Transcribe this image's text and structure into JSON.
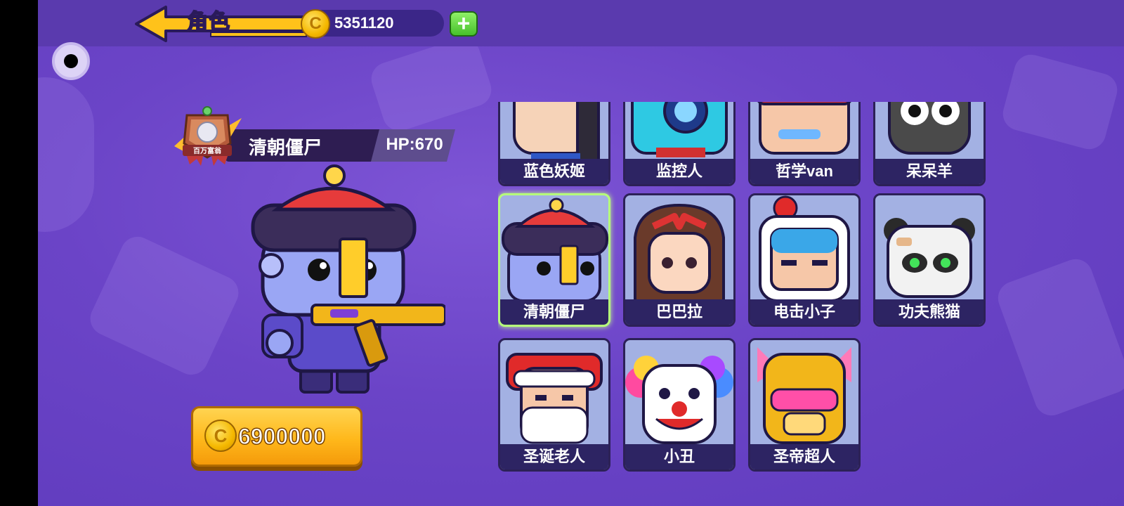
{
  "header": {
    "title": "角色",
    "coins": "5351120",
    "add_icon": "plus-icon"
  },
  "selected": {
    "name": "清朝僵尸",
    "hp": "HP:670",
    "badge_text": "百万富翁",
    "price": "6900000"
  },
  "characters": [
    {
      "label": "蓝色妖姬"
    },
    {
      "label": "监控人"
    },
    {
      "label": "哲学van"
    },
    {
      "label": "呆呆羊"
    },
    {
      "label": "清朝僵尸"
    },
    {
      "label": "巴巴拉"
    },
    {
      "label": "电击小子"
    },
    {
      "label": "功夫熊猫"
    },
    {
      "label": "圣诞老人"
    },
    {
      "label": "小丑"
    },
    {
      "label": "圣帝超人"
    }
  ],
  "colors": {
    "topbar": "#5a3aae",
    "background": "#6b44c7",
    "card": "#a3b1e3",
    "card_label": "#2d2463",
    "selected_border": "#b6ff7a",
    "coin": "#f5b800",
    "buy_button": "#ffb81b"
  }
}
